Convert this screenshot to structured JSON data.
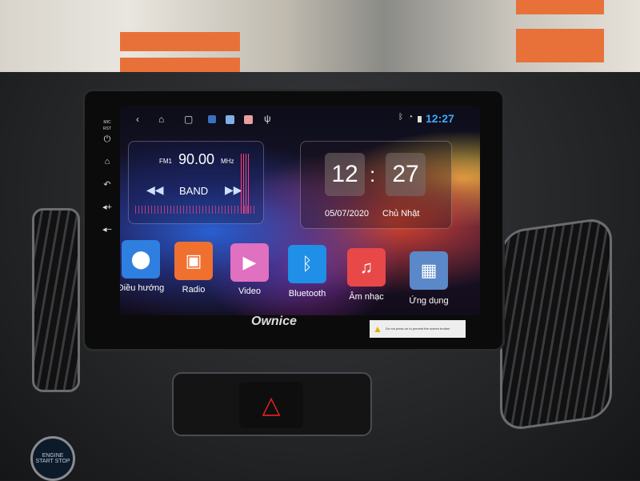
{
  "status_bar": {
    "time": "12:27",
    "icons": [
      "back-icon",
      "home-icon",
      "recent-apps-icon",
      "app-icon",
      "photo-app-icon",
      "app-icon-2",
      "usb-icon",
      "bluetooth-icon",
      "wifi-icon",
      "battery-icon"
    ]
  },
  "side_labels": {
    "mic": "MIC",
    "rst": "RST"
  },
  "radio": {
    "band_name": "FM1",
    "frequency": "90.00",
    "unit": "MHz",
    "band_label": "BAND"
  },
  "clock": {
    "hour": "12",
    "minute": "27",
    "separator": ":",
    "date": "05/07/2020",
    "weekday": "Chủ Nhật"
  },
  "apps": [
    {
      "label": "Điều hướng",
      "icon": "map-pin-icon",
      "color": "#2f7fe0"
    },
    {
      "label": "Radio",
      "icon": "radio-icon",
      "color": "#f07030"
    },
    {
      "label": "Video",
      "icon": "video-icon",
      "color": "#e070c0"
    },
    {
      "label": "Bluetooth",
      "icon": "bluetooth-icon",
      "color": "#1f8fe8"
    },
    {
      "label": "Âm nhạc",
      "icon": "music-icon",
      "color": "#e84848"
    },
    {
      "label": "Ứng dụng",
      "icon": "apps-grid-icon",
      "color": "#5a88c8"
    }
  ],
  "brand": "Ownice",
  "warning_sticker": "Do not press on to prevent the screen broken",
  "start_button": "ENGINE START STOP",
  "colors": {
    "clock_accent": "#3fa8ff",
    "hazard": "#e02020"
  }
}
